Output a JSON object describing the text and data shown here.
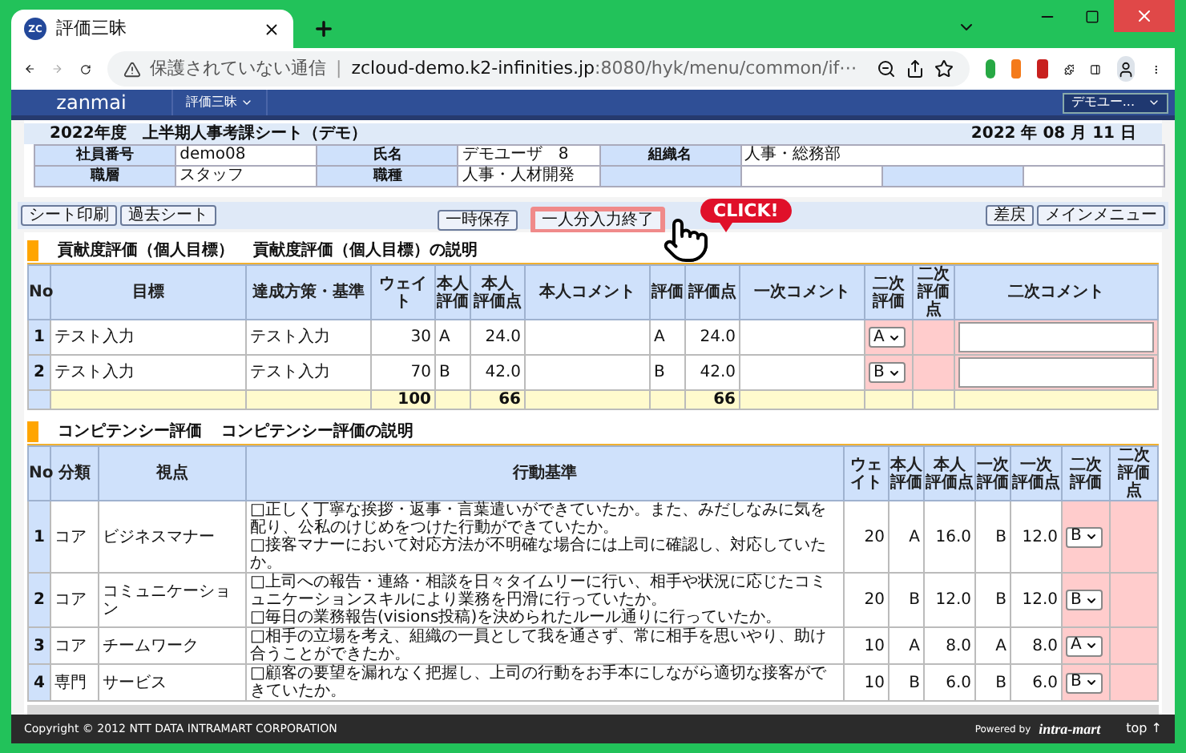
{
  "browser": {
    "tab_title": "評価三昧",
    "tab_favicon": "ZC",
    "address_warning": "保護されていない通信",
    "separator": "|",
    "url_host": "zcloud-demo.k2-infinities.jp",
    "url_path": ":8080/hyk/menu/common/if⋯"
  },
  "app": {
    "logo": "zanmai",
    "menu": "評価三昧",
    "user_menu": "デモユー..."
  },
  "sheet": {
    "title": "2022年度　上半期人事考課シート（デモ）",
    "date": "2022 年 08 月 11 日",
    "info": [
      [
        {
          "label": "社員番号",
          "value": "demo08"
        },
        {
          "label": "氏名",
          "value": "デモユーザ　8"
        },
        {
          "label": "組織名",
          "value": "人事・総務部"
        }
      ],
      [
        {
          "label": "職層",
          "value": "スタッフ"
        },
        {
          "label": "職種",
          "value": "人事・人材開発"
        }
      ]
    ]
  },
  "toolbar": {
    "left": [
      "シート印刷",
      "過去シート"
    ],
    "center": [
      {
        "label": "一時保存",
        "highlighted": false
      },
      {
        "label": "一人分入力終了",
        "highlighted": true
      }
    ],
    "right": [
      "差戻",
      "メインメニュー"
    ]
  },
  "callout": "CLICK!",
  "goals": {
    "title": "貢献度評価（個人目標）",
    "link": "貢献度評価（個人目標）の説明",
    "columns": [
      [
        "No"
      ],
      [
        "目標"
      ],
      [
        "達成方策・基準"
      ],
      [
        "ウェイト"
      ],
      [
        "本人",
        "評価"
      ],
      [
        "本人",
        "評価点"
      ],
      [
        "本人コメント"
      ],
      [
        "評価"
      ],
      [
        "評価点"
      ],
      [
        "一次コメント"
      ],
      [
        "二次",
        "評価"
      ],
      [
        "二次",
        "評価点"
      ],
      [
        "二次コメント"
      ]
    ],
    "rows": [
      {
        "no": "1",
        "goal": "テスト入力",
        "method": "テスト入力",
        "weight": "30",
        "self_grade": "A",
        "self_score": "24.0",
        "first_grade": "A",
        "first_score": "24.0",
        "second_grade": "A"
      },
      {
        "no": "2",
        "goal": "テスト入力",
        "method": "テスト入力",
        "weight": "70",
        "self_grade": "B",
        "self_score": "42.0",
        "first_grade": "B",
        "first_score": "42.0",
        "second_grade": "B"
      }
    ],
    "total": {
      "weight": "100",
      "self_score": "66",
      "first_score": "66"
    }
  },
  "competency": {
    "title": "コンピテンシー評価",
    "link": "コンピテンシー評価の説明",
    "columns": [
      [
        "No"
      ],
      [
        "分類"
      ],
      [
        "視点"
      ],
      [
        "行動基準"
      ],
      [
        "ウェイト"
      ],
      [
        "本人",
        "評価"
      ],
      [
        "本人",
        "評価点"
      ],
      [
        "一次",
        "評価"
      ],
      [
        "一次",
        "評価点"
      ],
      [
        "二次",
        "評価"
      ],
      [
        "二次",
        "評価点"
      ]
    ],
    "rows": [
      {
        "no": "1",
        "category": "コア",
        "viewpoint": "ビジネスマナー",
        "criteria": [
          "□正しく丁寧な挨拶・返事・言葉遣いができていたか。また、みだしなみに気を配り、公私のけじめをつけた行動ができていたか。",
          "□接客マナーにおいて対応方法が不明確な場合には上司に確認し、対応していたか。"
        ],
        "weight": "20",
        "self_grade": "A",
        "self_score": "16.0",
        "first_grade": "B",
        "first_score": "12.0",
        "second_grade": "B"
      },
      {
        "no": "2",
        "category": "コア",
        "viewpoint": "コミュニケーション",
        "criteria": [
          "□上司への報告・連絡・相談を日々タイムリーに行い、相手や状況に応じたコミュニケーションスキルにより業務を円滑に行っていたか。",
          "□毎日の業務報告(visions投稿)を決められたルール通りに行っていたか。"
        ],
        "weight": "20",
        "self_grade": "B",
        "self_score": "12.0",
        "first_grade": "B",
        "first_score": "12.0",
        "second_grade": "B"
      },
      {
        "no": "3",
        "category": "コア",
        "viewpoint": "チームワーク",
        "criteria": [
          "□相手の立場を考え、組織の一員として我を通さず、常に相手を思いやり、助け合うことができたか。"
        ],
        "weight": "10",
        "self_grade": "A",
        "self_score": "8.0",
        "first_grade": "A",
        "first_score": "8.0",
        "second_grade": "A"
      },
      {
        "no": "4",
        "category": "専門",
        "viewpoint": "サービス",
        "criteria": [
          "□顧客の要望を漏れなく把握し、上司の行動をお手本にしながら適切な接客ができていたか。"
        ],
        "weight": "10",
        "self_grade": "B",
        "self_score": "6.0",
        "first_grade": "B",
        "first_score": "6.0",
        "second_grade": "B"
      }
    ]
  },
  "footer": {
    "copyright": "Copyright © 2012 NTT DATA INTRAMART CORPORATION",
    "powered": "Powered by",
    "brand": "intra-mart",
    "top": "top ↑"
  }
}
